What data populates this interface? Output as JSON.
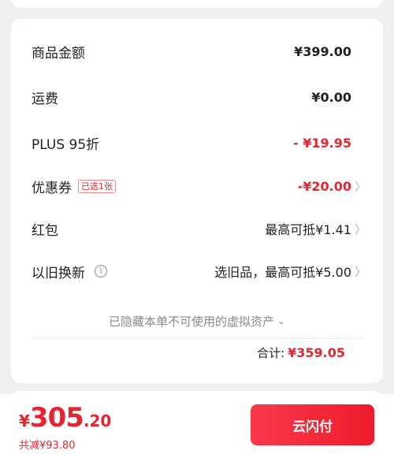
{
  "summary": {
    "goods_amount": {
      "label": "商品金额",
      "value": "¥399.00"
    },
    "shipping": {
      "label": "运费",
      "value": "¥0.00"
    },
    "plus_discount": {
      "label": "PLUS 95折",
      "value": "- ¥19.95"
    },
    "coupon": {
      "label": "优惠券",
      "badge": "已选1张",
      "value": "-¥20.00"
    },
    "red_packet": {
      "label": "红包",
      "value": "最高可抵¥1.41"
    },
    "trade_in": {
      "label": "以旧换新",
      "value": "选旧品，最高可抵¥5.00"
    },
    "hidden_assets_note": "已隐藏本单不可使用的虚拟资产",
    "total": {
      "label": "合计:",
      "value": "¥359.05"
    }
  },
  "bottom_bar": {
    "currency": "¥",
    "amount_int": "305",
    "amount_dec": ".20",
    "saving": "共减¥93.80",
    "pay_button": "云闪付"
  },
  "icons": {
    "chevron": "chevron-right-icon",
    "info": "info-icon",
    "chevron_down": "chevron-down-icon"
  },
  "colors": {
    "accent_red": "#e3262f",
    "button_red": "#f02a38",
    "muted_text": "#8a8a8a"
  }
}
